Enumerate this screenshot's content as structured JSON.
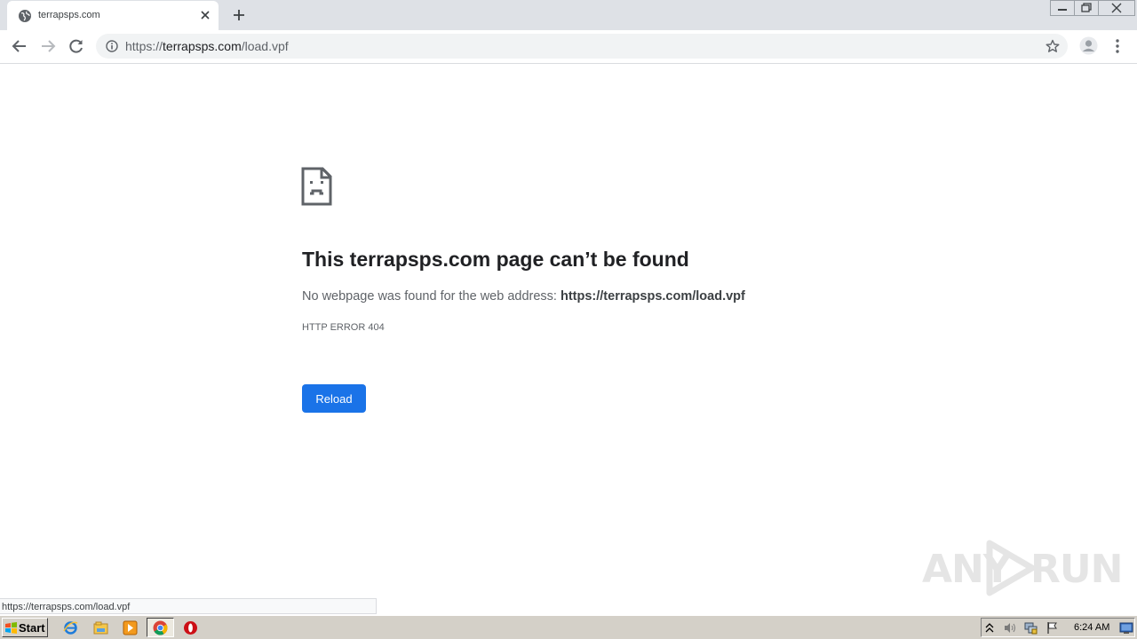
{
  "browser": {
    "tab": {
      "title": "terrapsps.com",
      "favicon": "globe-icon"
    },
    "new_tab_icon": "plus-icon",
    "window_controls": [
      "minimize-icon",
      "restore-icon",
      "close-icon"
    ],
    "address_bar": {
      "scheme": "https://",
      "host": "terrapsps.com",
      "path": "/load.vpf"
    },
    "status_url": "https://terrapsps.com/load.vpf"
  },
  "error_page": {
    "title": "This terrapsps.com page can’t be found",
    "description": "No webpage was found for the web address: ",
    "url": "https://terrapsps.com/load.vpf",
    "code": "HTTP ERROR 404",
    "reload_label": "Reload"
  },
  "watermark": {
    "left": "ANY",
    "right": "RUN"
  },
  "taskbar": {
    "start_label": "Start",
    "quick_launch": [
      "ie-icon",
      "explorer-icon",
      "media-player-icon"
    ],
    "running": [
      "chrome-icon",
      "opera-icon"
    ],
    "tray": [
      "chevron-up-icon",
      "speaker-icon",
      "network-icon",
      "flag-icon",
      "monitor-icon"
    ],
    "time": "6:24 AM"
  },
  "colors": {
    "tabstrip": "#dee1e6",
    "accent": "#1a73e8",
    "taskbar": "#d4d0c8"
  }
}
